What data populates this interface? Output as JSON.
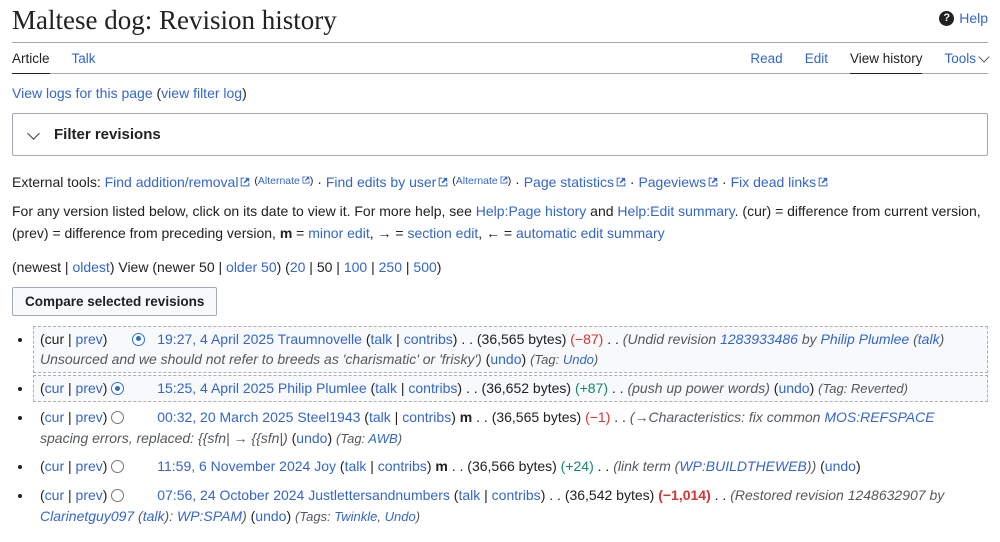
{
  "header": {
    "title": "Maltese dog: Revision history",
    "help": "Help"
  },
  "tabs": {
    "article": "Article",
    "talk": "Talk",
    "read": "Read",
    "edit": "Edit",
    "view_history": "View history",
    "tools": "Tools"
  },
  "view_logs": [
    {
      "t": "View logs for this page",
      "s": "link"
    },
    {
      "t": " (",
      "s": "plain"
    },
    {
      "t": "view filter log",
      "s": "link"
    },
    {
      "t": ")",
      "s": "plain"
    }
  ],
  "filter": {
    "label": "Filter revisions"
  },
  "external_tools": [
    {
      "t": "External tools: ",
      "s": "plain"
    },
    {
      "t": "Find addition/removal",
      "s": "link"
    },
    {
      "t": "",
      "s": "ext"
    },
    {
      "t": " ",
      "s": "plain"
    },
    {
      "t": "(",
      "s": "small"
    },
    {
      "t": "Alternate",
      "s": "smalllink"
    },
    {
      "t": "",
      "s": "ext-small"
    },
    {
      "t": ")",
      "s": "small"
    },
    {
      "t": " · ",
      "s": "plain"
    },
    {
      "t": "Find edits by user",
      "s": "link"
    },
    {
      "t": "",
      "s": "ext"
    },
    {
      "t": " ",
      "s": "plain"
    },
    {
      "t": "(",
      "s": "small"
    },
    {
      "t": "Alternate",
      "s": "smalllink"
    },
    {
      "t": "",
      "s": "ext-small"
    },
    {
      "t": ")",
      "s": "small"
    },
    {
      "t": " · ",
      "s": "plain"
    },
    {
      "t": "Page statistics",
      "s": "link"
    },
    {
      "t": "",
      "s": "ext"
    },
    {
      "t": " · ",
      "s": "plain"
    },
    {
      "t": "Pageviews",
      "s": "link"
    },
    {
      "t": "",
      "s": "ext"
    },
    {
      "t": " · ",
      "s": "plain"
    },
    {
      "t": "Fix dead links",
      "s": "link"
    },
    {
      "t": "",
      "s": "ext"
    }
  ],
  "help_text": [
    {
      "t": "For any version listed below, click on its date to view it. For more help, see ",
      "s": "plain"
    },
    {
      "t": "Help:Page history",
      "s": "link"
    },
    {
      "t": " and ",
      "s": "plain"
    },
    {
      "t": "Help:Edit summary",
      "s": "link"
    },
    {
      "t": ". (cur) = difference from current version, (prev) = difference from preceding version, ",
      "s": "plain"
    },
    {
      "t": "m",
      "s": "bold"
    },
    {
      "t": " = ",
      "s": "plain"
    },
    {
      "t": "minor edit",
      "s": "link"
    },
    {
      "t": ", → = ",
      "s": "plain"
    },
    {
      "t": "section edit",
      "s": "link"
    },
    {
      "t": ", ← = ",
      "s": "plain"
    },
    {
      "t": "automatic edit summary",
      "s": "link"
    }
  ],
  "pagination": [
    {
      "t": "(newest",
      "s": "plain"
    },
    {
      "t": " | ",
      "s": "plain"
    },
    {
      "t": "oldest",
      "s": "link"
    },
    {
      "t": ") View (newer 50",
      "s": "plain"
    },
    {
      "t": " | ",
      "s": "plain"
    },
    {
      "t": "older 50",
      "s": "link"
    },
    {
      "t": ") (",
      "s": "plain"
    },
    {
      "t": "20",
      "s": "link"
    },
    {
      "t": " | ",
      "s": "plain"
    },
    {
      "t": "50",
      "s": "plain"
    },
    {
      "t": " | ",
      "s": "plain"
    },
    {
      "t": "100",
      "s": "link"
    },
    {
      "t": " | ",
      "s": "plain"
    },
    {
      "t": "250",
      "s": "link"
    },
    {
      "t": " | ",
      "s": "plain"
    },
    {
      "t": "500",
      "s": "link"
    },
    {
      "t": ")",
      "s": "plain"
    }
  ],
  "compare_button": "Compare selected revisions",
  "ui": {
    "open": "(",
    "close": ")",
    "pipe": " | ",
    "dots": ". .",
    "open_sp": " ("
  },
  "revisions": [
    {
      "cur": "cur",
      "cur_class": "plain",
      "prev": "prev",
      "prev_class": "link",
      "radio": "right-on",
      "time": "19:27, 4 April 2025",
      "user": "Traumnovelle",
      "talk": "talk",
      "contribs": "contribs",
      "minor": "",
      "bytes": "(36,565 bytes)",
      "diff": "(−87)",
      "diff_class": "neg",
      "comment": [
        {
          "t": "(Undid revision ",
          "s": "plain"
        },
        {
          "t": "1283933486",
          "s": "link"
        },
        {
          "t": " by ",
          "s": "plain"
        },
        {
          "t": "Philip Plumlee",
          "s": "link"
        },
        {
          "t": " (",
          "s": "plain"
        },
        {
          "t": "talk",
          "s": "link"
        },
        {
          "t": ") Unsourced and we should not refer to breeds as 'charismatic' or 'frisky')",
          "s": "plain"
        }
      ],
      "undo": "undo",
      "tags": [
        {
          "t": "(Tag: ",
          "s": "gray"
        },
        {
          "t": "Undo",
          "s": "taglink"
        },
        {
          "t": ")",
          "s": "gray"
        }
      ],
      "row_class": "selected"
    },
    {
      "cur": "cur",
      "cur_class": "link",
      "prev": "prev",
      "prev_class": "link",
      "radio": "left-on",
      "time": "15:25, 4 April 2025",
      "user": "Philip Plumlee",
      "talk": "talk",
      "contribs": "contribs",
      "minor": "",
      "bytes": "(36,652 bytes)",
      "diff": "(+87)",
      "diff_class": "pos",
      "comment": [
        {
          "t": "(push up power words)",
          "s": "plain"
        }
      ],
      "undo": "undo",
      "tags": [
        {
          "t": "(Tag: Reverted)",
          "s": "gray"
        }
      ],
      "row_class": "selected"
    },
    {
      "cur": "cur",
      "cur_class": "link",
      "prev": "prev",
      "prev_class": "link",
      "radio": "left-off",
      "time": "00:32, 20 March 2025",
      "user": "Steel1943",
      "talk": "talk",
      "contribs": "contribs",
      "minor": "m",
      "bytes": "(36,565 bytes)",
      "diff": "(−1)",
      "diff_class": "neg",
      "comment": [
        {
          "t": "(",
          "s": "plain"
        },
        {
          "t": "→Characteristics:",
          "s": "gray"
        },
        {
          "t": " fix common ",
          "s": "plain"
        },
        {
          "t": "MOS:REFSPACE",
          "s": "link"
        },
        {
          "t": " spacing errors, replaced: {{sfn| → {{sfn|)",
          "s": "plain"
        }
      ],
      "undo": "undo",
      "tags": [
        {
          "t": "(Tag: ",
          "s": "gray"
        },
        {
          "t": "AWB",
          "s": "taglink"
        },
        {
          "t": ")",
          "s": "gray"
        }
      ],
      "row_class": ""
    },
    {
      "cur": "cur",
      "cur_class": "link",
      "prev": "prev",
      "prev_class": "link",
      "radio": "left-off",
      "time": "11:59, 6 November 2024",
      "user": "Joy",
      "talk": "talk",
      "contribs": "contribs",
      "minor": "m",
      "bytes": "(36,566 bytes)",
      "diff": "(+24)",
      "diff_class": "pos",
      "comment": [
        {
          "t": "(link term (",
          "s": "plain"
        },
        {
          "t": "WP:BUILDTHEWEB",
          "s": "link"
        },
        {
          "t": "))",
          "s": "plain"
        }
      ],
      "undo": "undo",
      "tags": [],
      "row_class": ""
    },
    {
      "cur": "cur",
      "cur_class": "link",
      "prev": "prev",
      "prev_class": "link",
      "radio": "left-off",
      "time": "07:56, 24 October 2024",
      "user": "Justlettersandnumbers",
      "talk": "talk",
      "contribs": "contribs",
      "minor": "",
      "bytes": "(36,542 bytes)",
      "diff": "(−1,014)",
      "diff_class": "neg bold",
      "comment": [
        {
          "t": "(Restored revision 1248632907 by ",
          "s": "plain"
        },
        {
          "t": "Clarinetguy097",
          "s": "link"
        },
        {
          "t": " (",
          "s": "plain"
        },
        {
          "t": "talk",
          "s": "link"
        },
        {
          "t": "): ",
          "s": "plain"
        },
        {
          "t": "WP:SPAM",
          "s": "link"
        },
        {
          "t": ")",
          "s": "plain"
        }
      ],
      "undo": "undo",
      "tags": [
        {
          "t": "(Tags: ",
          "s": "gray"
        },
        {
          "t": "Twinkle",
          "s": "taglink"
        },
        {
          "t": ", ",
          "s": "gray"
        },
        {
          "t": "Undo",
          "s": "taglink"
        },
        {
          "t": ")",
          "s": "gray"
        }
      ],
      "row_class": ""
    }
  ],
  "colors": {
    "link_blue": "#3366cc",
    "positive_green": "#14866d",
    "negative_red": "#d73333",
    "border_gray": "#a2a9b1",
    "selected_row_bg": "#f8f9fa"
  }
}
